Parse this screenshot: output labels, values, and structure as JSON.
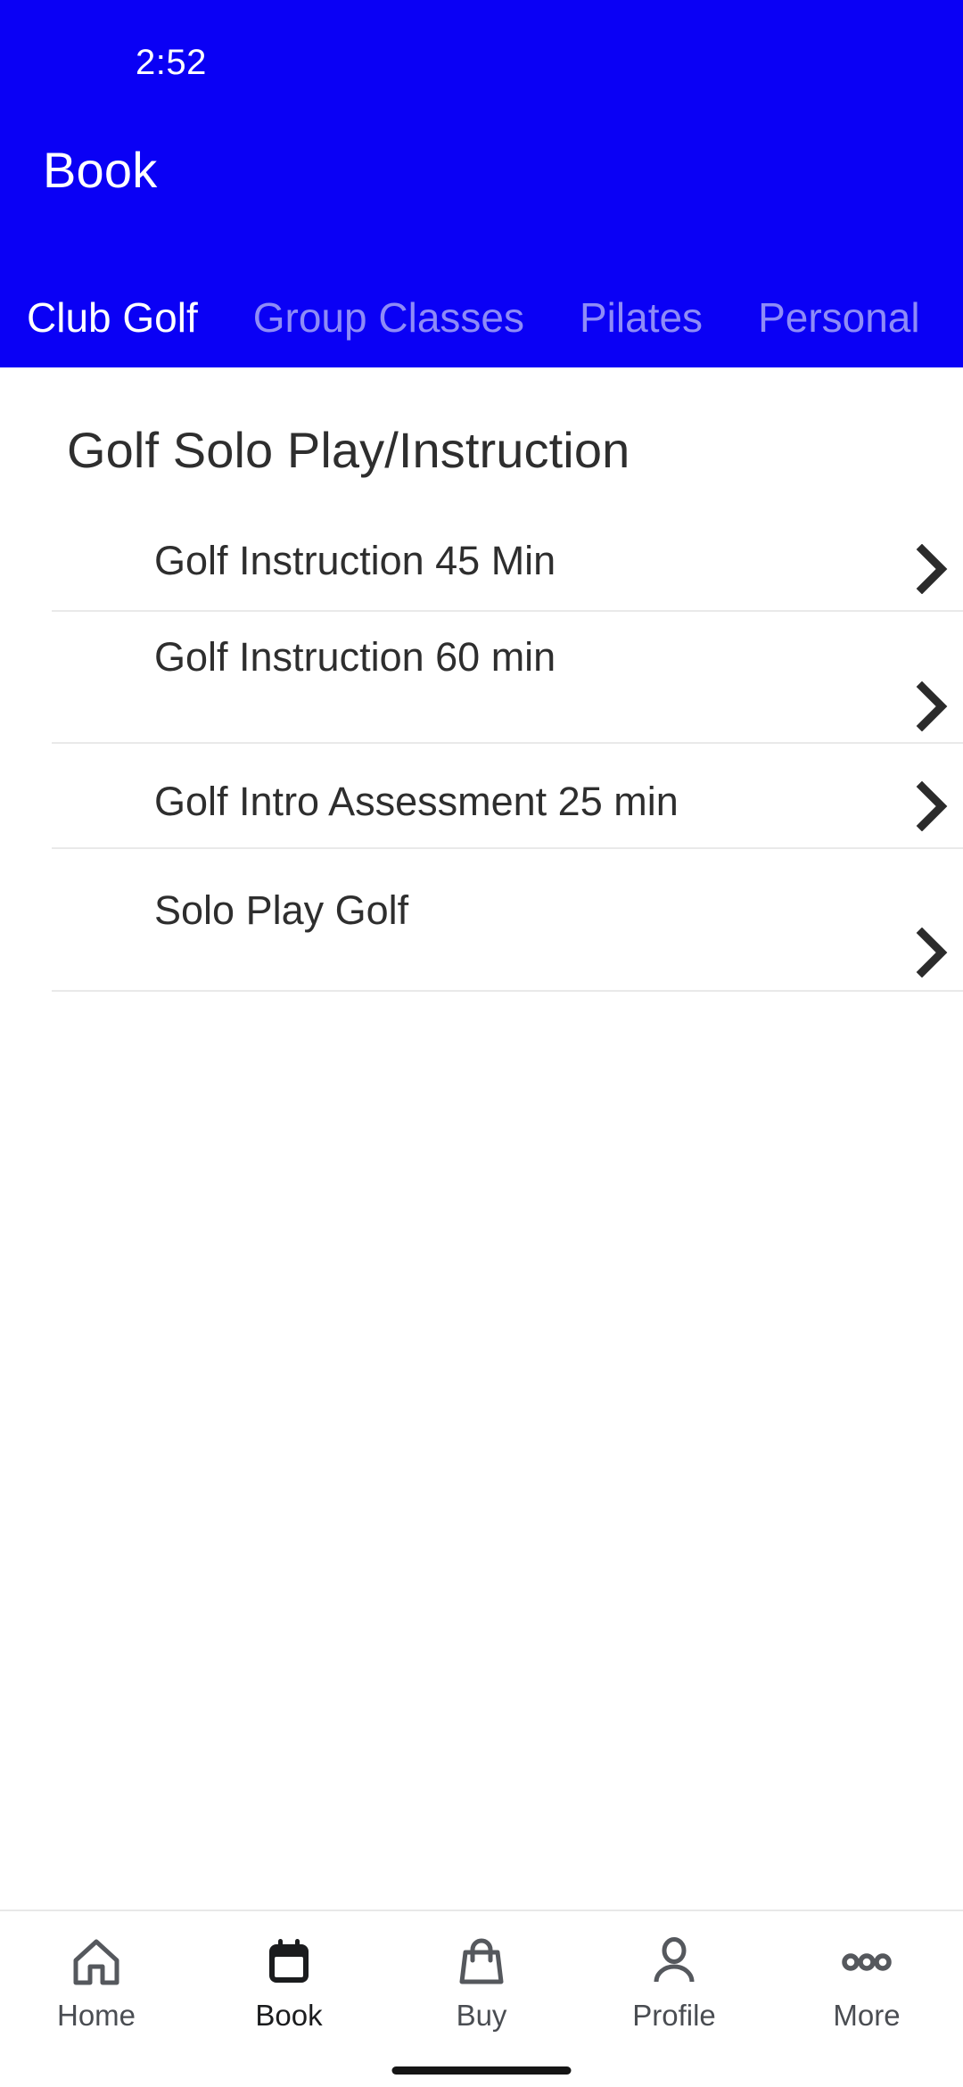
{
  "theme": {
    "header_bg": "#0a00f5",
    "header_text": "#ffffff",
    "tab_inactive": "#8e8bf7",
    "body_text": "#2e2e2e",
    "separator": "#e9e9e9",
    "nav_inactive": "#4a4d52",
    "nav_active": "#1b1c1e",
    "page_bg": "#ffffff"
  },
  "status_bar": {
    "time": "2:52"
  },
  "header": {
    "title": "Book",
    "tabs": [
      {
        "label": "Club Golf",
        "active": true
      },
      {
        "label": "Group Classes",
        "active": false
      },
      {
        "label": "Pilates",
        "active": false
      },
      {
        "label": "Personal",
        "active": false
      }
    ]
  },
  "main": {
    "section_title": "Golf Solo Play/Instruction",
    "items": [
      {
        "label": "Golf Instruction 45 Min",
        "chevron": "chevron-right-icon"
      },
      {
        "label": "Golf Instruction 60 min",
        "chevron": "chevron-right-icon"
      },
      {
        "label": "Golf Intro Assessment 25 min",
        "chevron": "chevron-right-icon"
      },
      {
        "label": "Solo Play Golf",
        "chevron": "chevron-right-icon"
      }
    ]
  },
  "bottom_nav": {
    "items": [
      {
        "label": "Home",
        "icon": "home-icon",
        "active": false
      },
      {
        "label": "Book",
        "icon": "calendar-icon",
        "active": true
      },
      {
        "label": "Buy",
        "icon": "shopping-bag-icon",
        "active": false
      },
      {
        "label": "Profile",
        "icon": "person-icon",
        "active": false
      },
      {
        "label": "More",
        "icon": "ellipsis-icon",
        "active": false
      }
    ]
  }
}
